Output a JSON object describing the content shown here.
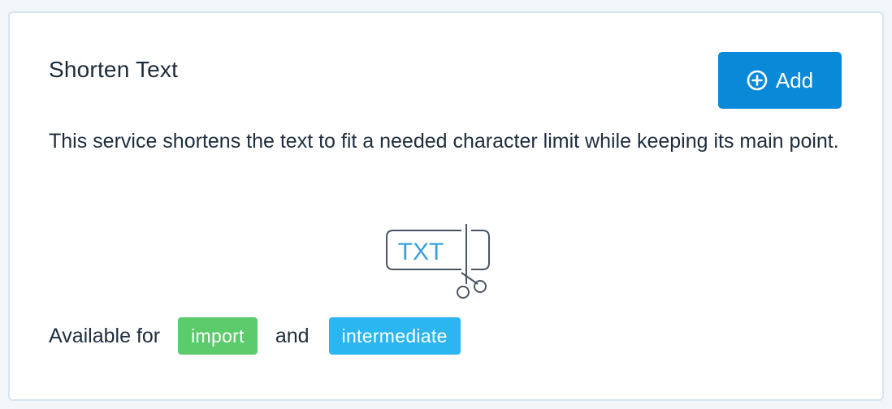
{
  "card": {
    "title": "Shorten Text",
    "description": "This service shortens the text to fit a needed character limit while keeping its main point.",
    "add_button": {
      "label": "Add",
      "icon": "plus-circle-icon"
    },
    "illustration": {
      "icon": "txt-scissors-icon",
      "label": "TXT"
    },
    "availability": {
      "prefix": "Available for",
      "connector": "and",
      "badges": [
        {
          "label": "import",
          "color": "#5ccb6b"
        },
        {
          "label": "intermediate",
          "color": "#2bb6f2"
        }
      ]
    }
  },
  "colors": {
    "accent": "#0a89d8",
    "card_border": "#d5e6f2",
    "text": "#1f2d3d",
    "illustration_text": "#3aa0d8",
    "illustration_stroke": "#4a5563"
  }
}
